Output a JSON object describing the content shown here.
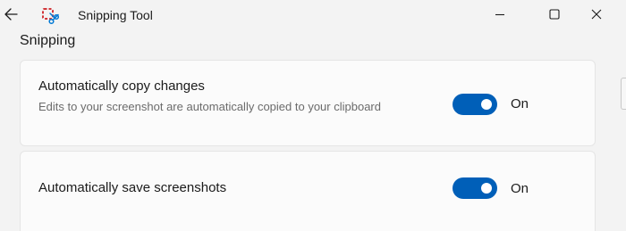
{
  "window": {
    "title": "Snipping Tool",
    "icons": {
      "back": "arrow-left-icon",
      "app": "snipping-tool-icon",
      "minimize": "minimize-icon",
      "maximize": "maximize-icon",
      "close": "close-icon"
    }
  },
  "section": {
    "title": "Snipping"
  },
  "settings": [
    {
      "title": "Automatically copy changes",
      "description": "Edits to your screenshot are automatically copied to your clipboard",
      "toggle_on": true,
      "state_label": "On"
    },
    {
      "title": "Automatically save screenshots",
      "toggle_on": true,
      "state_label": "On"
    }
  ],
  "colors": {
    "accent": "#005fb8",
    "background": "#f3f3f3",
    "card": "#fbfbfb",
    "app_icon_red": "#d13438",
    "app_icon_blue": "#0078d4"
  }
}
